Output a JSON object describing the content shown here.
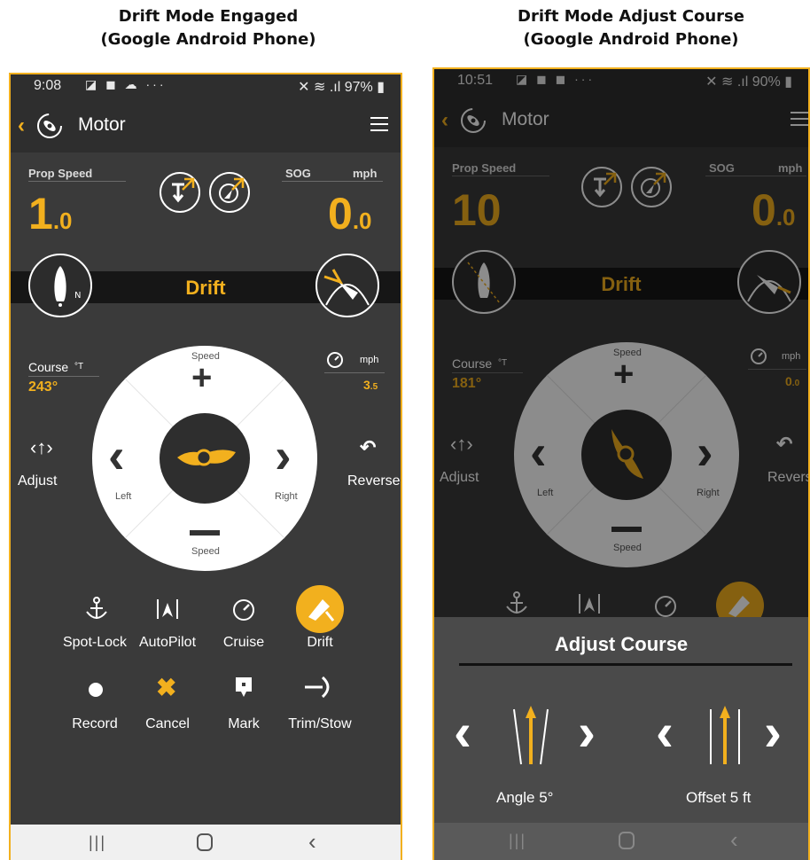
{
  "captions": {
    "left_line1": "Drift Mode Engaged",
    "left_line2": "(Google Android Phone)",
    "right_line1": "Drift Mode Adjust Course",
    "right_line2": "(Google Android Phone)"
  },
  "left_phone": {
    "status": {
      "time": "9:08",
      "notif_icons": "◪ ◼ ☁ ···",
      "right": "✕ ≋ .ıl 97% ▮"
    },
    "title": "Motor",
    "prop_speed": {
      "label": "Prop Speed",
      "int": "1",
      "dec": ".0"
    },
    "sog": {
      "label": "SOG",
      "unit": "mph",
      "int": "0",
      "dec": ".0"
    },
    "mode": "Drift",
    "course": {
      "label": "Course",
      "unit": "°T",
      "value": "243°"
    },
    "speed_readout": {
      "unit": "mph",
      "int": "3",
      "dec": ".5"
    },
    "wheel": {
      "top": "Speed",
      "bottom": "Speed",
      "left": "Left",
      "right": "Right"
    },
    "adjust": "Adjust",
    "reverse": "Reverse",
    "buttons_row1": [
      "Spot-Lock",
      "AutoPilot",
      "Cruise",
      "Drift"
    ],
    "buttons_row2": [
      "Record",
      "Cancel",
      "Mark",
      "Trim/Stow"
    ]
  },
  "right_phone": {
    "status": {
      "time": "10:51",
      "notif_icons": "◪ ◼ ◼ ···",
      "right": "✕ ≋ .ıl 90% ▮"
    },
    "title": "Motor",
    "prop_speed": {
      "label": "Prop Speed",
      "int": "10",
      "dec": ""
    },
    "sog": {
      "label": "SOG",
      "unit": "mph",
      "int": "0",
      "dec": ".0"
    },
    "mode": "Drift",
    "course": {
      "label": "Course",
      "unit": "°T",
      "value": "181°"
    },
    "speed_readout": {
      "unit": "mph",
      "int": "0",
      "dec": ".0"
    },
    "wheel": {
      "top": "Speed",
      "bottom": "Speed",
      "left": "Left",
      "right": "Right"
    },
    "adjust": "Adjust",
    "reverse": "Revers",
    "sheet_title": "Adjust Course",
    "angle_label": "Angle 5°",
    "offset_label": "Offset 5 ft"
  },
  "colors": {
    "accent": "#f2b01e",
    "panel": "#3a3a3a",
    "bar": "#2e2e2e"
  }
}
